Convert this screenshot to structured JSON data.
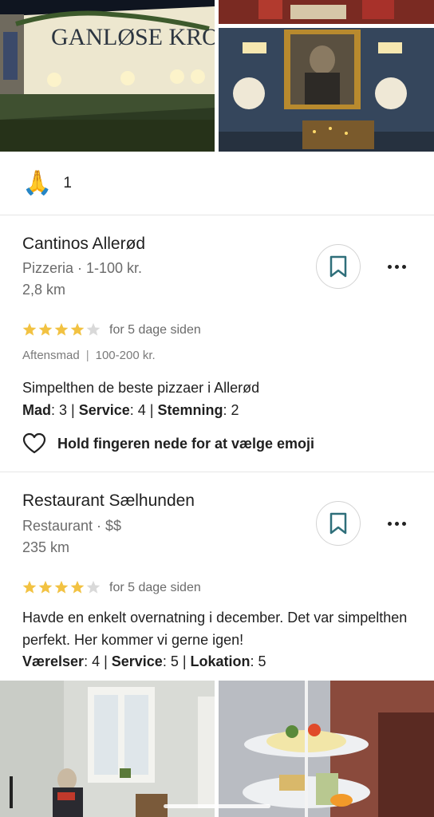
{
  "top_photos": {
    "left_sign": "GANLØSE KRO"
  },
  "reaction": {
    "emoji": "🙏",
    "count": "1"
  },
  "reviews": [
    {
      "name": "Cantinos Allerød",
      "meta": "Pizzeria · 1-100 kr.",
      "distance": "2,8 km",
      "stars": 4,
      "stars_max": 5,
      "when": "for 5 dage siden",
      "tag_meal": "Aftensmad",
      "tag_sep": "|",
      "tag_price": "100-200 kr.",
      "text": "Simpelthen de beste pizzaer i Allerød",
      "ratings": [
        {
          "label": "Mad",
          "value": "3"
        },
        {
          "label": "Service",
          "value": "4"
        },
        {
          "label": "Stemning",
          "value": "2"
        }
      ],
      "like_hint": "Hold fingeren nede for at vælge emoji"
    },
    {
      "name": "Restaurant Sælhunden",
      "meta": "Restaurant · $$",
      "distance": "235 km",
      "stars": 4,
      "stars_max": 5,
      "when": "for 5 dage siden",
      "text": "Havde en enkelt overnatning i december. Det var simpelthen perfekt. Her kommer vi gerne igen!",
      "ratings": [
        {
          "label": "Værelser",
          "value": "4"
        },
        {
          "label": "Service",
          "value": "5"
        },
        {
          "label": "Lokation",
          "value": "5"
        }
      ]
    }
  ],
  "colors": {
    "star_filled": "#f2c242",
    "star_empty": "#d9d9d9",
    "bookmark": "#2f6f7a"
  }
}
